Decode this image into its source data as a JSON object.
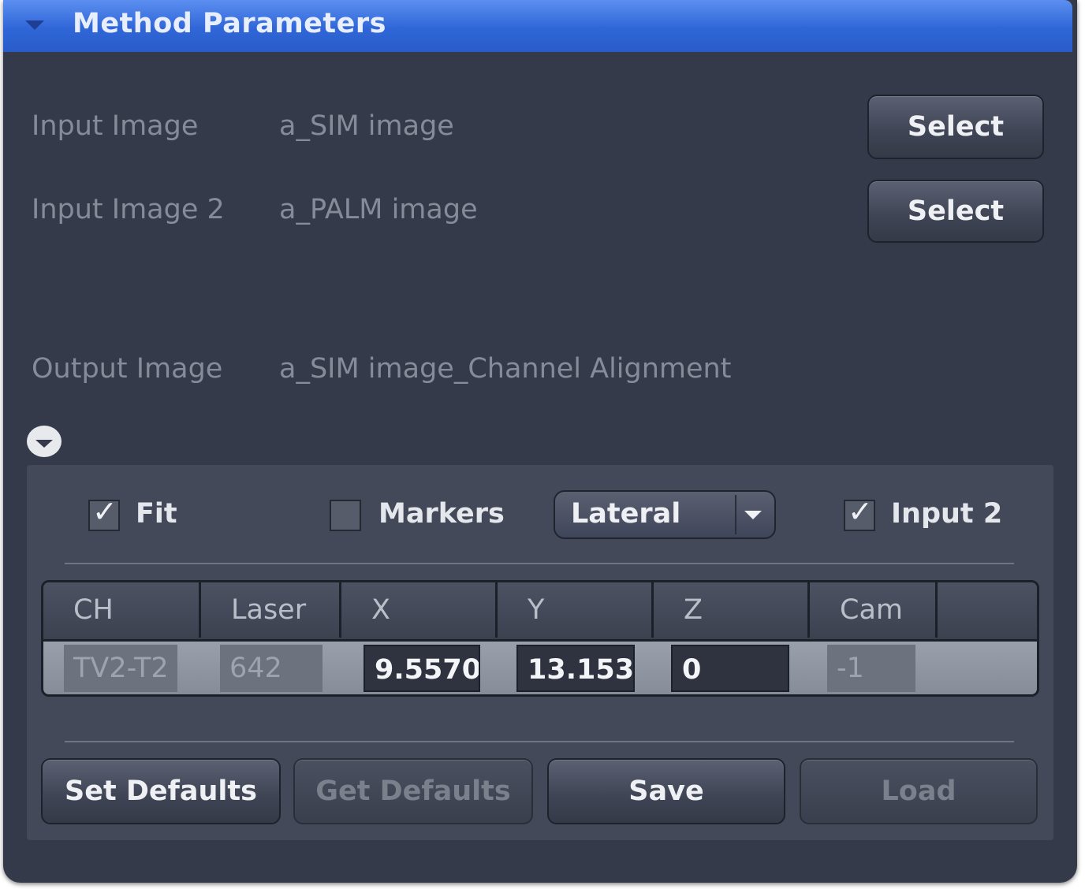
{
  "header": {
    "title": "Method Parameters"
  },
  "inputs": [
    {
      "label": "Input Image",
      "value": "a_SIM image",
      "button": "Select"
    },
    {
      "label": "Input Image 2",
      "value": "a_PALM image",
      "button": "Select"
    }
  ],
  "output": {
    "label": "Output Image",
    "value": "a_SIM image_Channel Alignment"
  },
  "options": {
    "fit": {
      "label": "Fit",
      "checked": true,
      "mark": "✓"
    },
    "markers": {
      "label": "Markers",
      "checked": false
    },
    "mode": {
      "selected": "Lateral"
    },
    "input2": {
      "label": "Input 2",
      "checked": true,
      "mark": "✓"
    }
  },
  "table": {
    "headers": [
      "CH",
      "Laser",
      "X",
      "Y",
      "Z",
      "Cam"
    ],
    "rows": [
      {
        "ch": "TV2-T2",
        "laser": "642",
        "x": "9.5570",
        "y": "13.153",
        "z": "0",
        "cam": "-1"
      }
    ]
  },
  "buttons": {
    "set_defaults": "Set Defaults",
    "get_defaults": "Get Defaults",
    "save": "Save",
    "load": "Load"
  }
}
